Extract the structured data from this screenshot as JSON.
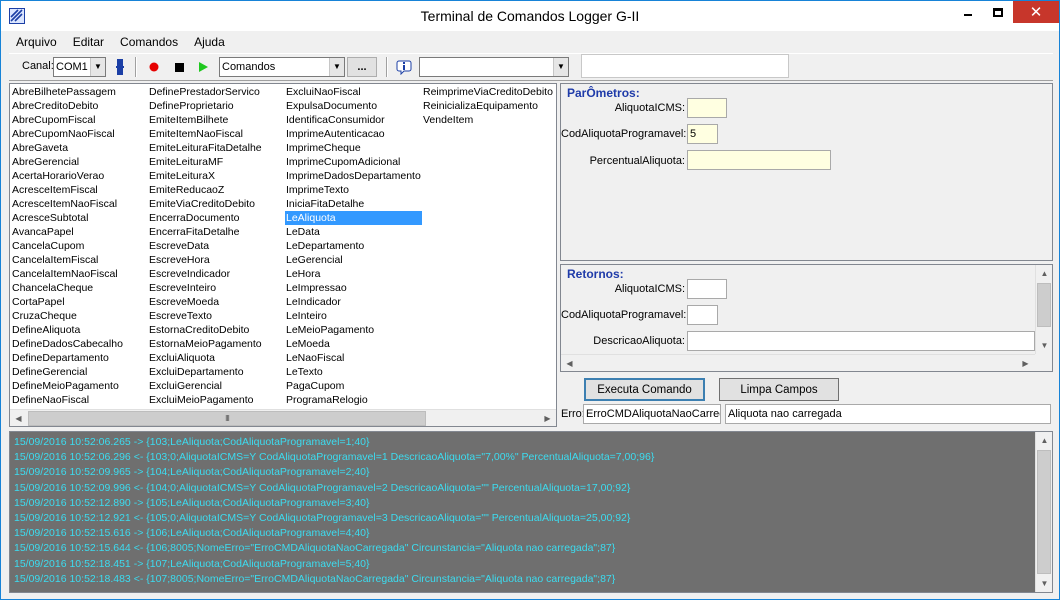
{
  "window": {
    "title": "Terminal de Comandos Logger G-II",
    "controls": {
      "minimize": "—",
      "maximize": "☐",
      "close": "✕"
    }
  },
  "menu": [
    "Arquivo",
    "Editar",
    "Comandos",
    "Ajuda"
  ],
  "toolbar": {
    "canal_label": "Canal:",
    "canal_value": "COM1",
    "comandos_value": "Comandos",
    "dots_label": "...",
    "filter_value": ""
  },
  "commands": {
    "columns": [
      [
        "AbreBilhetePassagem",
        "AbreCreditoDebito",
        "AbreCupomFiscal",
        "AbreCupomNaoFiscal",
        "AbreGaveta",
        "AbreGerencial",
        "AcertaHorarioVerao",
        "AcresceItemFiscal",
        "AcresceItemNaoFiscal",
        "AcresceSubtotal",
        "AvancaPapel",
        "CancelaCupom",
        "CancelaItemFiscal",
        "CancelaItemNaoFiscal",
        "ChancelaCheque",
        "CortaPapel",
        "CruzaCheque",
        "DefineAliquota",
        "DefineDadosCabecalho",
        "DefineDepartamento",
        "DefineGerencial",
        "DefineMeioPagamento",
        "DefineNaoFiscal"
      ],
      [
        "DefinePrestadorServico",
        "DefineProprietario",
        "EmiteItemBilhete",
        "EmiteItemNaoFiscal",
        "EmiteLeituraFitaDetalhe",
        "EmiteLeituraMF",
        "EmiteLeituraX",
        "EmiteReducaoZ",
        "EmiteViaCreditoDebito",
        "EncerraDocumento",
        "EncerraFitaDetalhe",
        "EscreveData",
        "EscreveHora",
        "EscreveIndicador",
        "EscreveInteiro",
        "EscreveMoeda",
        "EscreveTexto",
        "EstornaCreditoDebito",
        "EstornaMeioPagamento",
        "ExcluiAliquota",
        "ExcluiDepartamento",
        "ExcluiGerencial",
        "ExcluiMeioPagamento"
      ],
      [
        "ExcluiNaoFiscal",
        "ExpulsaDocumento",
        "IdentificaConsumidor",
        "ImprimeAutenticacao",
        "ImprimeCheque",
        "ImprimeCupomAdicional",
        "ImprimeDadosDepartamento",
        "ImprimeTexto",
        "IniciaFitaDetalhe",
        "LeAliquota",
        "LeData",
        "LeDepartamento",
        "LeGerencial",
        "LeHora",
        "LeImpressao",
        "LeIndicador",
        "LeInteiro",
        "LeMeioPagamento",
        "LeMoeda",
        "LeNaoFiscal",
        "LeTexto",
        "PagaCupom",
        "ProgramaRelogio"
      ],
      [
        "ReimprimeViaCreditoDebito",
        "ReinicializaEquipamento",
        "VendeItem"
      ]
    ],
    "selected": "LeAliquota",
    "scroll_thumb": "III"
  },
  "parametros": {
    "title": "ParÔmetros:",
    "fields": [
      {
        "label": "AliquotaICMS:",
        "value": ""
      },
      {
        "label": "CodAliquotaProgramavel:",
        "value": "5"
      },
      {
        "label": "PercentualAliquota:",
        "value": ""
      }
    ]
  },
  "retornos": {
    "title": "Retornos:",
    "fields": [
      {
        "label": "AliquotaICMS:",
        "value": ""
      },
      {
        "label": "CodAliquotaProgramavel:",
        "value": ""
      },
      {
        "label": "DescricaoAliquota:",
        "value": ""
      }
    ]
  },
  "actions": {
    "executa": "Executa Comando",
    "limpa": "Limpa Campos"
  },
  "erro": {
    "label": "Erro:",
    "code": "ErroCMDAliquotaNaoCarreg",
    "message": "Aliquota nao carregada"
  },
  "log": [
    "15/09/2016 10:52:06.265 -> {103;LeAliquota;CodAliquotaProgramavel=1;40}",
    "15/09/2016 10:52:06.296 <- {103;0;AliquotaICMS=Y CodAliquotaProgramavel=1 DescricaoAliquota=\"7,00%\" PercentualAliquota=7,00;96}",
    "15/09/2016 10:52:09.965 -> {104;LeAliquota;CodAliquotaProgramavel=2;40}",
    "15/09/2016 10:52:09.996 <- {104;0;AliquotaICMS=Y CodAliquotaProgramavel=2 DescricaoAliquota=\"\" PercentualAliquota=17,00;92}",
    "15/09/2016 10:52:12.890 -> {105;LeAliquota;CodAliquotaProgramavel=3;40}",
    "15/09/2016 10:52:12.921 <- {105;0;AliquotaICMS=Y CodAliquotaProgramavel=3 DescricaoAliquota=\"\" PercentualAliquota=25,00;92}",
    "15/09/2016 10:52:15.616 -> {106;LeAliquota;CodAliquotaProgramavel=4;40}",
    "15/09/2016 10:52:15.644 <- {106;8005;NomeErro=\"ErroCMDAliquotaNaoCarregada\" Circunstancia=\"Aliquota nao carregada\";87}",
    "15/09/2016 10:52:18.451 -> {107;LeAliquota;CodAliquotaProgramavel=5;40}",
    "15/09/2016 10:52:18.483 <- {107;8005;NomeErro=\"ErroCMDAliquotaNaoCarregada\" Circunstancia=\"Aliquota nao carregada\";87}"
  ],
  "colors": {
    "title_blue": "#1f3ba9",
    "selection": "#3399ff",
    "log_bg": "#6f6f6f",
    "log_text": "#3cdcf0",
    "field_yellow": "#ffffe1",
    "close_red": "#c7362b"
  }
}
